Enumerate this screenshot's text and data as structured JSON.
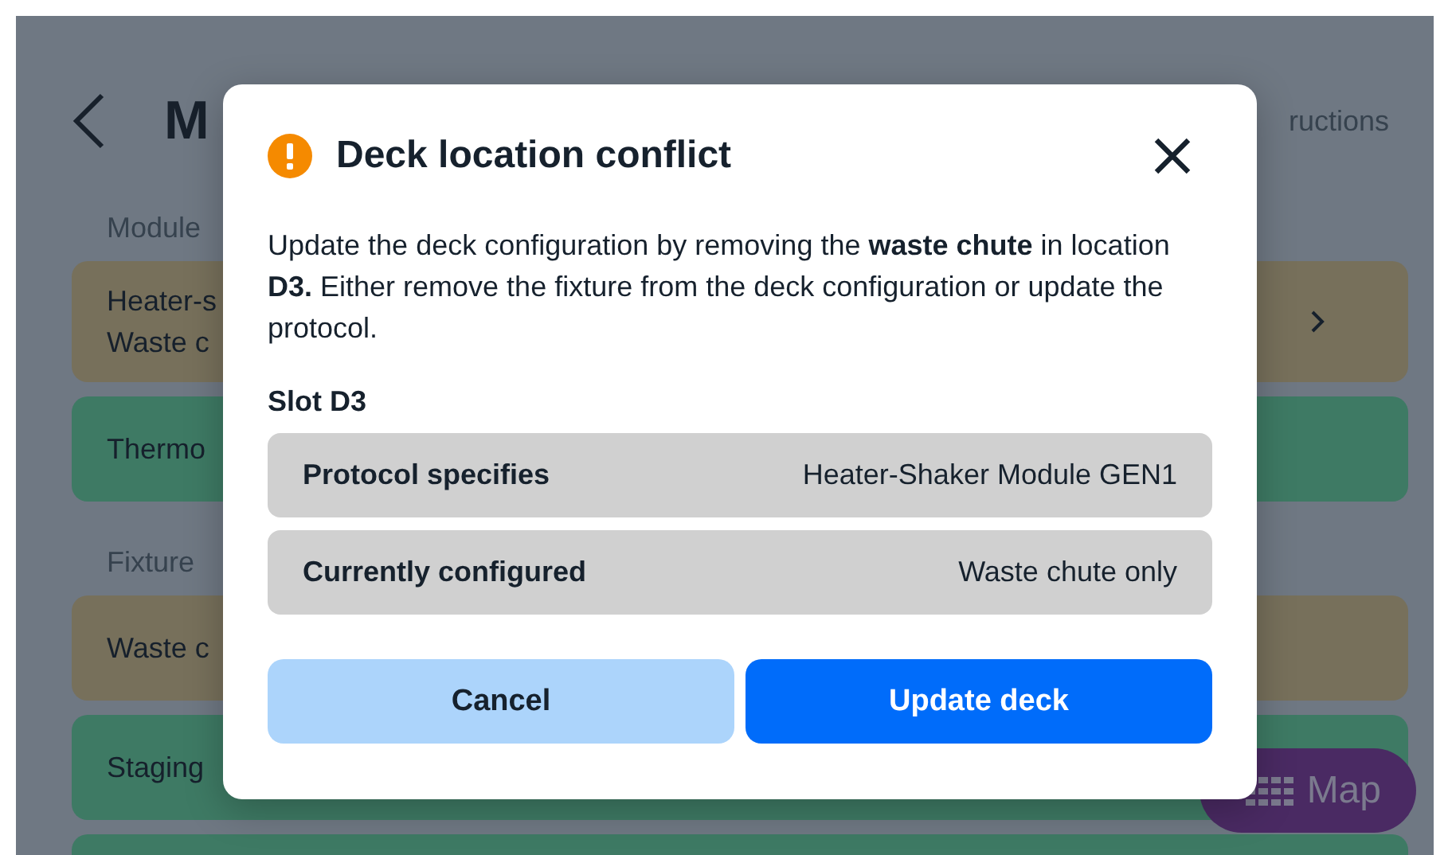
{
  "page": {
    "title": "M",
    "header_link": "ructions",
    "sections": [
      {
        "label": "Module",
        "rows": [
          {
            "color": "#77705b",
            "lines": [
              "Heater-s",
              "Waste c"
            ],
            "has_chevron": true
          },
          {
            "color": "#3e7a64",
            "lines": [
              "Thermo"
            ],
            "has_chevron": false
          }
        ]
      },
      {
        "label": "Fixture",
        "rows": [
          {
            "color": "#77705b",
            "lines": [
              "Waste c"
            ],
            "has_chevron": false
          },
          {
            "color": "#3e7a64",
            "lines": [
              "Staging"
            ],
            "has_chevron": false
          },
          {
            "color": "#3e7a64",
            "lines": [],
            "has_chevron": false
          }
        ]
      }
    ],
    "map_button": {
      "label": "Map"
    }
  },
  "modal": {
    "title": "Deck location conflict",
    "message": "Update the deck configuration by removing the **waste chute** in location **D3.** Either remove the fixture from the deck configuration or update the protocol.",
    "slot_label": "Slot D3",
    "rows": [
      {
        "label": "Protocol specifies",
        "value": "Heater-Shaker Module GEN1"
      },
      {
        "label": "Currently configured",
        "value": "Waste chute only"
      }
    ],
    "buttons": [
      {
        "label": "Cancel",
        "kind": "secondary"
      },
      {
        "label": "Update deck",
        "kind": "primary"
      }
    ]
  }
}
